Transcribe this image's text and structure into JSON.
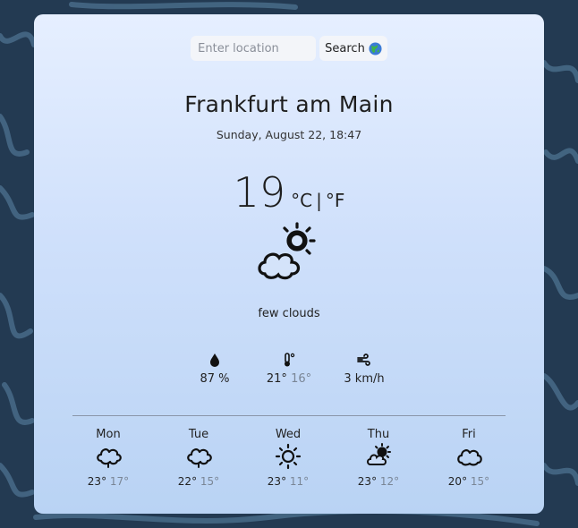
{
  "search": {
    "placeholder": "Enter location",
    "button_label": "Search"
  },
  "location": {
    "city": "Frankfurt am Main",
    "datetime": "Sunday, August 22, 18:47"
  },
  "current": {
    "temperature": "19",
    "unit_c": "°C",
    "unit_sep": "|",
    "unit_f": "°F",
    "description": "few clouds",
    "icon": "partly-cloudy-icon"
  },
  "stats": {
    "humidity": "87 %",
    "feels_high": "21°",
    "feels_low": "16°",
    "wind": "3 km/h"
  },
  "forecast": [
    {
      "day": "Mon",
      "icon": "cloud-icon",
      "high": "23°",
      "low": "17°"
    },
    {
      "day": "Tue",
      "icon": "cloud-icon",
      "high": "22°",
      "low": "15°"
    },
    {
      "day": "Wed",
      "icon": "sun-icon",
      "high": "23°",
      "low": "11°"
    },
    {
      "day": "Thu",
      "icon": "partly-cloudy-icon",
      "high": "23°",
      "low": "12°"
    },
    {
      "day": "Fri",
      "icon": "cloud-icon",
      "high": "20°",
      "low": "15°"
    }
  ],
  "colors": {
    "background": "#233a52",
    "card_top": "#e6efff",
    "card_bottom": "#b9d3f4",
    "low_temp": "#7a8696"
  }
}
